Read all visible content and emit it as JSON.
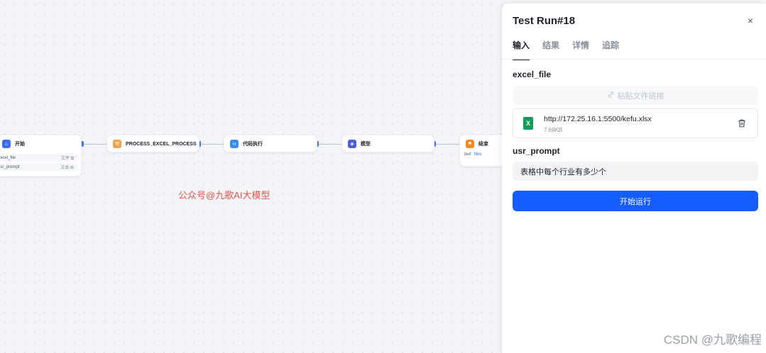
{
  "canvas": {
    "nodes": {
      "start": {
        "title": "开始",
        "icon": "home-icon",
        "color": "#3a6df0",
        "vars": [
          {
            "name": "excel_file",
            "type": "文件 ⧉"
          },
          {
            "name": "usr_prompt",
            "type": "文本 ⊞"
          }
        ]
      },
      "process": {
        "title": "PROCESS_EXCEL_PROCESS",
        "icon": "tool-icon",
        "color": "#f0a34a"
      },
      "code": {
        "title": "代码执行",
        "icon": "code-icon",
        "color": "#3a8bf0"
      },
      "model": {
        "title": "模型",
        "icon": "cube-icon",
        "color": "#4d5bd6"
      },
      "end": {
        "title": "结束",
        "icon": "flag-icon",
        "color": "#f5891f",
        "out_label": "text",
        "out_value": "files"
      }
    },
    "watermark": "公众号@九歌AI大模型",
    "csdn_watermark": "CSDN @九歌编程"
  },
  "panel": {
    "title": "Test Run#18",
    "close": "×",
    "tabs": [
      {
        "label": "输入"
      },
      {
        "label": "结果"
      },
      {
        "label": "详情"
      },
      {
        "label": "追踪"
      }
    ],
    "active_tab": 0,
    "excel_field": {
      "label": "excel_file",
      "paste_placeholder": "粘贴文件链接",
      "file": {
        "url": "http://172.25.16.1:5500/kefu.xlsx",
        "size": "7.69KB",
        "badge": "X"
      }
    },
    "prompt_field": {
      "label": "usr_prompt",
      "value": "表格中每个行业有多少个"
    },
    "run_button": "开始运行"
  },
  "colors": {
    "accent": "#165dff",
    "excel": "#0f9d58",
    "watermark": "#e8564a"
  }
}
